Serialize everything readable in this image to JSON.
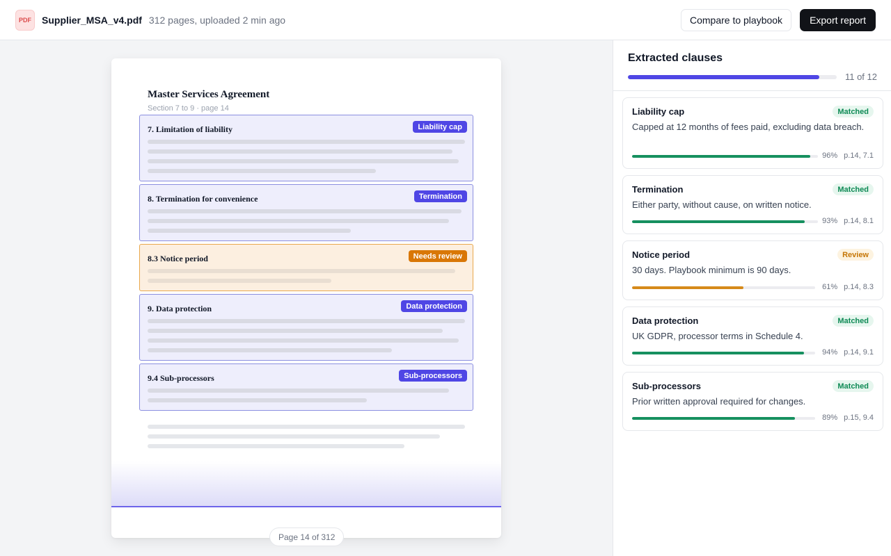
{
  "header": {
    "file_icon": "PDF",
    "file_name": "Supplier_MSA_v4.pdf",
    "file_meta": "312 pages, uploaded 2 min ago",
    "compare_label": "Compare to playbook",
    "export_label": "Export report"
  },
  "document": {
    "title": "Master Services Agreement",
    "subtitle": "Section 7 to 9 · page 14",
    "clauses": [
      {
        "heading": "7. Limitation of liability",
        "tag": "Liability cap",
        "status": "matched"
      },
      {
        "heading": "8. Termination for convenience",
        "tag": "Termination",
        "status": "matched"
      },
      {
        "heading": "8.3 Notice period",
        "tag": "Needs review",
        "status": "review"
      },
      {
        "heading": "9. Data protection",
        "tag": "Data protection",
        "status": "matched"
      },
      {
        "heading": "9.4 Sub-processors",
        "tag": "Sub-processors",
        "status": "matched"
      }
    ],
    "page_indicator": "Page 14 of 312"
  },
  "panel": {
    "title": "Extracted clauses",
    "progress_fraction": 0.9167,
    "progress_label": "11 of 12",
    "cards": [
      {
        "title": "Liability cap",
        "badge": "Matched",
        "status": "matched",
        "description": "Capped at 12 months of fees paid, excluding data breach.",
        "confidence": 0.96,
        "confidence_label": "96%",
        "reference": "p.14, 7.1"
      },
      {
        "title": "Termination",
        "badge": "Matched",
        "status": "matched",
        "description": "Either party, without cause, on written notice.",
        "confidence": 0.93,
        "confidence_label": "93%",
        "reference": "p.14, 8.1"
      },
      {
        "title": "Notice period",
        "badge": "Review",
        "status": "review",
        "description": "30 days. Playbook minimum is 90 days.",
        "confidence": 0.61,
        "confidence_label": "61%",
        "reference": "p.14, 8.3"
      },
      {
        "title": "Data protection",
        "badge": "Matched",
        "status": "matched",
        "description": "UK GDPR, processor terms in Schedule 4.",
        "confidence": 0.94,
        "confidence_label": "94%",
        "reference": "p.14, 9.1"
      },
      {
        "title": "Sub-processors",
        "badge": "Matched",
        "status": "matched",
        "description": "Prior written approval required for changes.",
        "confidence": 0.89,
        "confidence_label": "89%",
        "reference": "p.15, 9.4"
      }
    ]
  },
  "colors": {
    "accent": "#4f46e5",
    "matched": "#16905f",
    "review": "#d68a1a",
    "primary_button": "#111318"
  },
  "icons": {
    "file": "pdf-file-icon"
  }
}
